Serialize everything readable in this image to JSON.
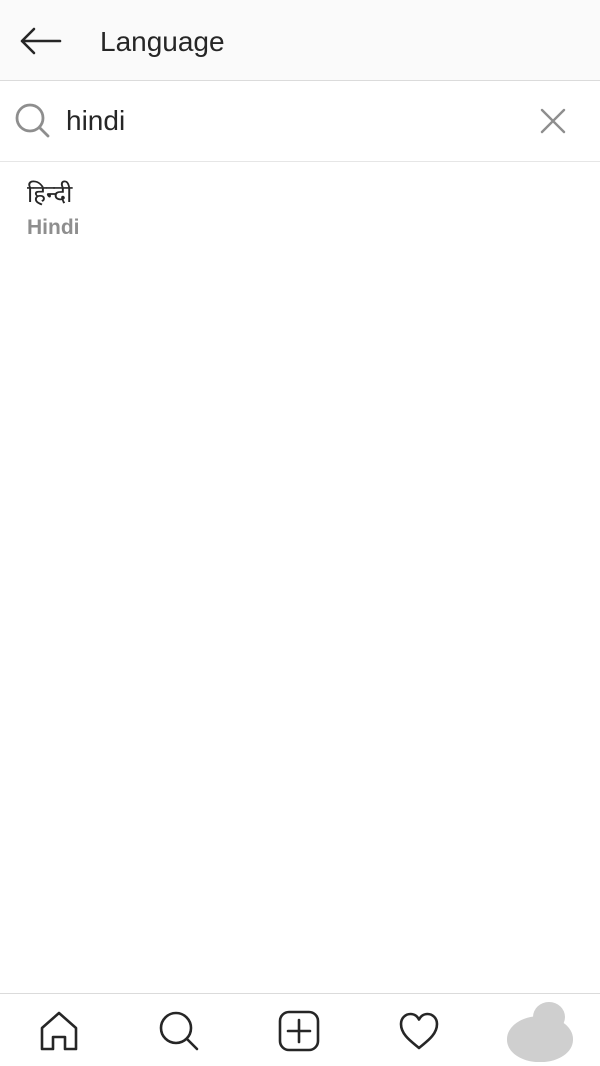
{
  "header": {
    "title": "Language",
    "back_icon": "arrow-left-icon"
  },
  "search": {
    "value": "hindi",
    "placeholder": "Search",
    "search_icon": "search-icon",
    "clear_icon": "close-icon"
  },
  "results": [
    {
      "native_name": "हिन्दी",
      "english_name": "Hindi"
    }
  ],
  "bottom_nav": {
    "items": [
      {
        "icon": "home-icon"
      },
      {
        "icon": "search-icon"
      },
      {
        "icon": "add-post-icon"
      },
      {
        "icon": "heart-icon"
      },
      {
        "icon": "profile-avatar"
      }
    ]
  },
  "colors": {
    "header_bg": "#fafafa",
    "text_primary": "#262626",
    "text_secondary": "#8e8e8e",
    "divider": "#dbdbdb",
    "icon_gray": "#8e8e8e",
    "avatar_placeholder": "#cfcfcf"
  }
}
